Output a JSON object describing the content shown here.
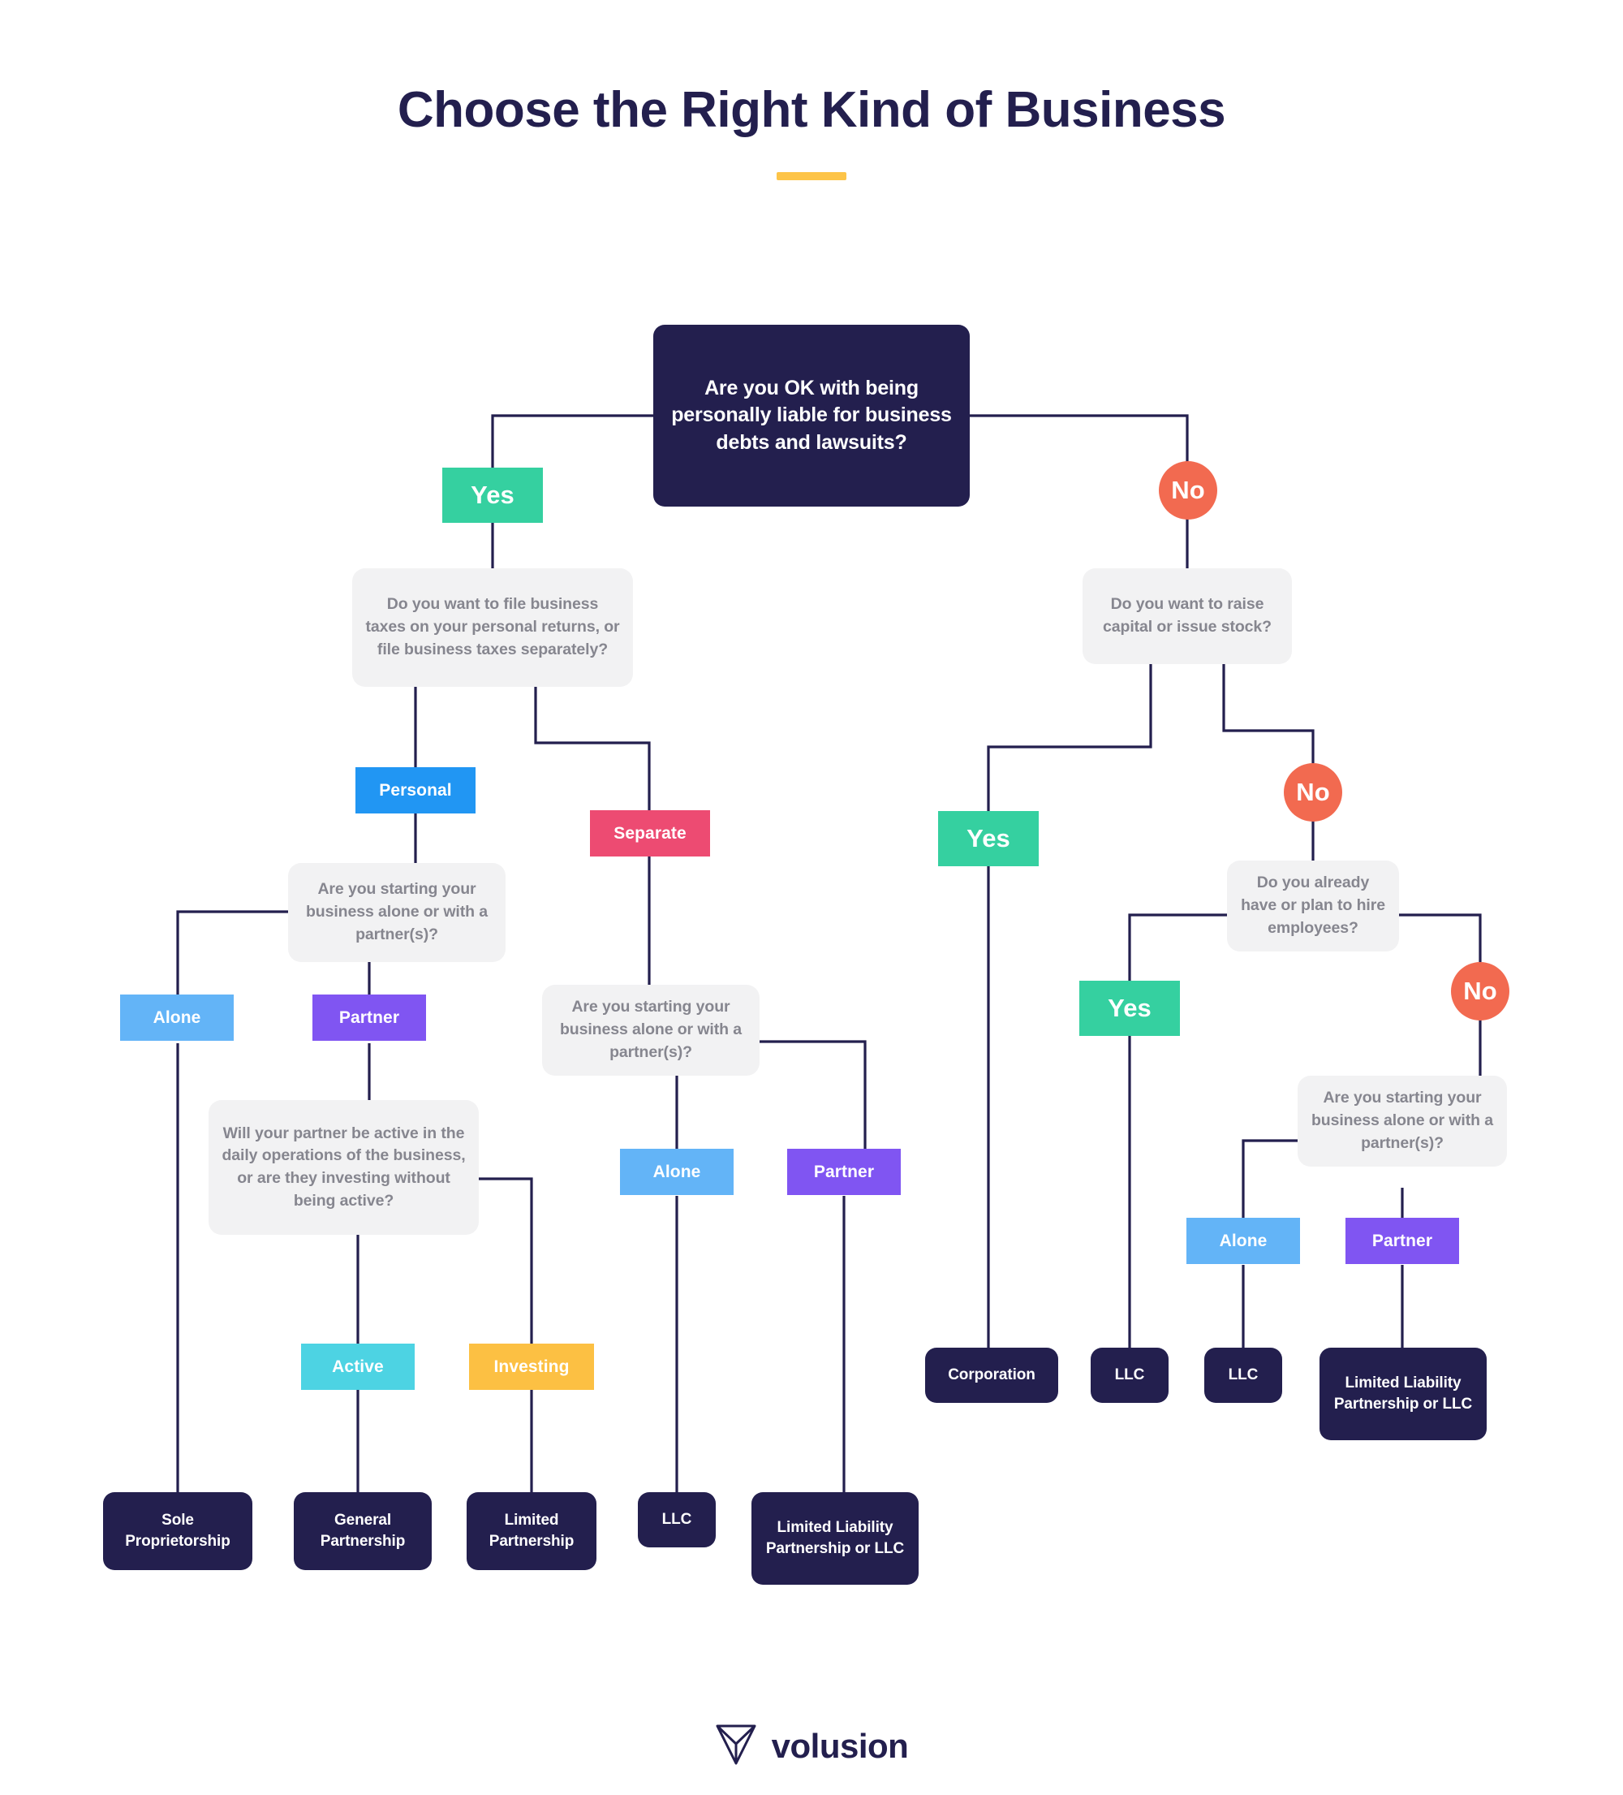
{
  "header": {
    "title": "Choose the Right Kind of Business"
  },
  "footer": {
    "brand": "volusion",
    "logo_icon": "volusion-diamond-icon"
  },
  "colors": {
    "dark_navy": "#231f4e",
    "light_gray_box": "#f2f2f3",
    "light_gray_text": "#86868f",
    "yes_green": "#35d0a0",
    "no_orange": "#f26a50",
    "personal_blue": "#2196f3",
    "alone_blue": "#63b4f7",
    "partner_purple": "#8055f2",
    "separate_pink": "#ed4b72",
    "active_cyan": "#4dd3e3",
    "investing_amber": "#fcc043",
    "accent_yellow": "#fdc448",
    "connector": "#231f4e",
    "background": "#ffffff"
  },
  "chart_data": {
    "type": "flowchart",
    "title": "Choose the Right Kind of Business",
    "nodes": [
      {
        "id": "q_root",
        "kind": "question-root",
        "text": "Are you OK with being personally liable for business debts and lawsuits?"
      },
      {
        "id": "lbl_yes_root",
        "kind": "label",
        "text": "Yes",
        "color": "#35d0a0",
        "shape": "rect"
      },
      {
        "id": "lbl_no_root",
        "kind": "label",
        "text": "No",
        "color": "#f26a50",
        "shape": "circle"
      },
      {
        "id": "q_taxes",
        "kind": "question",
        "text": "Do you want to file business taxes on your personal returns, or file business taxes separately?"
      },
      {
        "id": "q_capital",
        "kind": "question",
        "text": "Do you want to raise capital or issue stock?"
      },
      {
        "id": "lbl_personal",
        "kind": "label",
        "text": "Personal",
        "color": "#2196f3",
        "shape": "rect"
      },
      {
        "id": "lbl_separate",
        "kind": "label",
        "text": "Separate",
        "color": "#ed4b72",
        "shape": "rect"
      },
      {
        "id": "lbl_yes_corp",
        "kind": "label",
        "text": "Yes",
        "color": "#35d0a0",
        "shape": "rect"
      },
      {
        "id": "lbl_no_emp",
        "kind": "label",
        "text": "No",
        "color": "#f26a50",
        "shape": "circle"
      },
      {
        "id": "q_alone1",
        "kind": "question",
        "text": "Are you starting your business alone or with a partner(s)?"
      },
      {
        "id": "q_alone2",
        "kind": "question",
        "text": "Are you starting your business alone or with a partner(s)?"
      },
      {
        "id": "q_employees",
        "kind": "question",
        "text": "Do you already have or plan to hire employees?"
      },
      {
        "id": "q_alone3",
        "kind": "question",
        "text": "Are you starting your business alone or with a partner(s)?"
      },
      {
        "id": "lbl_alone1",
        "kind": "label",
        "text": "Alone",
        "color": "#63b4f7",
        "shape": "rect"
      },
      {
        "id": "lbl_partner1",
        "kind": "label",
        "text": "Partner",
        "color": "#8055f2",
        "shape": "rect"
      },
      {
        "id": "lbl_alone2",
        "kind": "label",
        "text": "Alone",
        "color": "#63b4f7",
        "shape": "rect"
      },
      {
        "id": "lbl_partner2",
        "kind": "label",
        "text": "Partner",
        "color": "#8055f2",
        "shape": "rect"
      },
      {
        "id": "lbl_alone3",
        "kind": "label",
        "text": "Alone",
        "color": "#63b4f7",
        "shape": "rect"
      },
      {
        "id": "lbl_partner3",
        "kind": "label",
        "text": "Partner",
        "color": "#8055f2",
        "shape": "rect"
      },
      {
        "id": "lbl_yes_emp",
        "kind": "label",
        "text": "Yes",
        "color": "#35d0a0",
        "shape": "rect"
      },
      {
        "id": "lbl_no_emp2",
        "kind": "label",
        "text": "No",
        "color": "#f26a50",
        "shape": "circle"
      },
      {
        "id": "q_active",
        "kind": "question",
        "text": "Will your partner be active in the daily operations of the business, or are they investing without being active?"
      },
      {
        "id": "lbl_active",
        "kind": "label",
        "text": "Active",
        "color": "#4dd3e3",
        "shape": "rect"
      },
      {
        "id": "lbl_investing",
        "kind": "label",
        "text": "Investing",
        "color": "#fcc043",
        "shape": "rect"
      },
      {
        "id": "r_sole",
        "kind": "result",
        "text": "Sole Proprietorship"
      },
      {
        "id": "r_general",
        "kind": "result",
        "text": "General Partnership"
      },
      {
        "id": "r_limited",
        "kind": "result",
        "text": "Limited Partnership"
      },
      {
        "id": "r_llc1",
        "kind": "result",
        "text": "LLC"
      },
      {
        "id": "r_llp1",
        "kind": "result",
        "text": "Limited Liability Partnership or LLC"
      },
      {
        "id": "r_corp",
        "kind": "result",
        "text": "Corporation"
      },
      {
        "id": "r_llc2",
        "kind": "result",
        "text": "LLC"
      },
      {
        "id": "r_llc3",
        "kind": "result",
        "text": "LLC"
      },
      {
        "id": "r_llp2",
        "kind": "result",
        "text": "Limited Liability Partnership or LLC"
      }
    ],
    "edges": [
      {
        "from": "q_root",
        "to": "q_taxes",
        "label": "Yes"
      },
      {
        "from": "q_root",
        "to": "q_capital",
        "label": "No"
      },
      {
        "from": "q_taxes",
        "to": "q_alone1",
        "label": "Personal"
      },
      {
        "from": "q_taxes",
        "to": "q_alone2",
        "label": "Separate"
      },
      {
        "from": "q_alone1",
        "to": "r_sole",
        "label": "Alone"
      },
      {
        "from": "q_alone1",
        "to": "q_active",
        "label": "Partner"
      },
      {
        "from": "q_active",
        "to": "r_general",
        "label": "Active"
      },
      {
        "from": "q_active",
        "to": "r_limited",
        "label": "Investing"
      },
      {
        "from": "q_alone2",
        "to": "r_llc1",
        "label": "Alone"
      },
      {
        "from": "q_alone2",
        "to": "r_llp1",
        "label": "Partner"
      },
      {
        "from": "q_capital",
        "to": "r_corp",
        "label": "Yes"
      },
      {
        "from": "q_capital",
        "to": "q_employees",
        "label": "No"
      },
      {
        "from": "q_employees",
        "to": "r_llc2",
        "label": "Yes"
      },
      {
        "from": "q_employees",
        "to": "q_alone3",
        "label": "No"
      },
      {
        "from": "q_alone3",
        "to": "r_llc3",
        "label": "Alone"
      },
      {
        "from": "q_alone3",
        "to": "r_llp2",
        "label": "Partner"
      }
    ]
  },
  "nodes": {
    "q_root": {
      "text": "Are you OK with being personally liable for business debts and lawsuits?"
    },
    "q_taxes": {
      "text": "Do you want to file business taxes on your personal returns, or file business taxes separately?"
    },
    "q_capital": {
      "text": "Do you want to raise capital or issue stock?"
    },
    "q_alone1": {
      "text": "Are you starting your business alone or with a partner(s)?"
    },
    "q_alone2": {
      "text": "Are you starting your business alone or with a partner(s)?"
    },
    "q_alone3": {
      "text": "Are you starting your business alone or with a partner(s)?"
    },
    "q_employees": {
      "text": "Do you already have or plan to hire employees?"
    },
    "q_active": {
      "text": "Will your partner be active in the daily operations of the business, or are they investing without being active?"
    },
    "lbl_yes_root": {
      "text": "Yes"
    },
    "lbl_no_root": {
      "text": "No"
    },
    "lbl_personal": {
      "text": "Personal"
    },
    "lbl_separate": {
      "text": "Separate"
    },
    "lbl_alone1": {
      "text": "Alone"
    },
    "lbl_partner1": {
      "text": "Partner"
    },
    "lbl_alone2": {
      "text": "Alone"
    },
    "lbl_partner2": {
      "text": "Partner"
    },
    "lbl_alone3": {
      "text": "Alone"
    },
    "lbl_partner3": {
      "text": "Partner"
    },
    "lbl_active": {
      "text": "Active"
    },
    "lbl_investing": {
      "text": "Investing"
    },
    "lbl_yes_corp": {
      "text": "Yes"
    },
    "lbl_no_emp": {
      "text": "No"
    },
    "lbl_yes_emp": {
      "text": "Yes"
    },
    "lbl_no_emp2": {
      "text": "No"
    },
    "r_sole": {
      "text": "Sole Proprietorship"
    },
    "r_general": {
      "text": "General Partnership"
    },
    "r_limited": {
      "text": "Limited Partnership"
    },
    "r_llc1": {
      "text": "LLC"
    },
    "r_llp1": {
      "text": "Limited Liability Partnership or LLC"
    },
    "r_corp": {
      "text": "Corporation"
    },
    "r_llc2": {
      "text": "LLC"
    },
    "r_llc3": {
      "text": "LLC"
    },
    "r_llp2": {
      "text": "Limited Liability Partnership or LLC"
    }
  }
}
